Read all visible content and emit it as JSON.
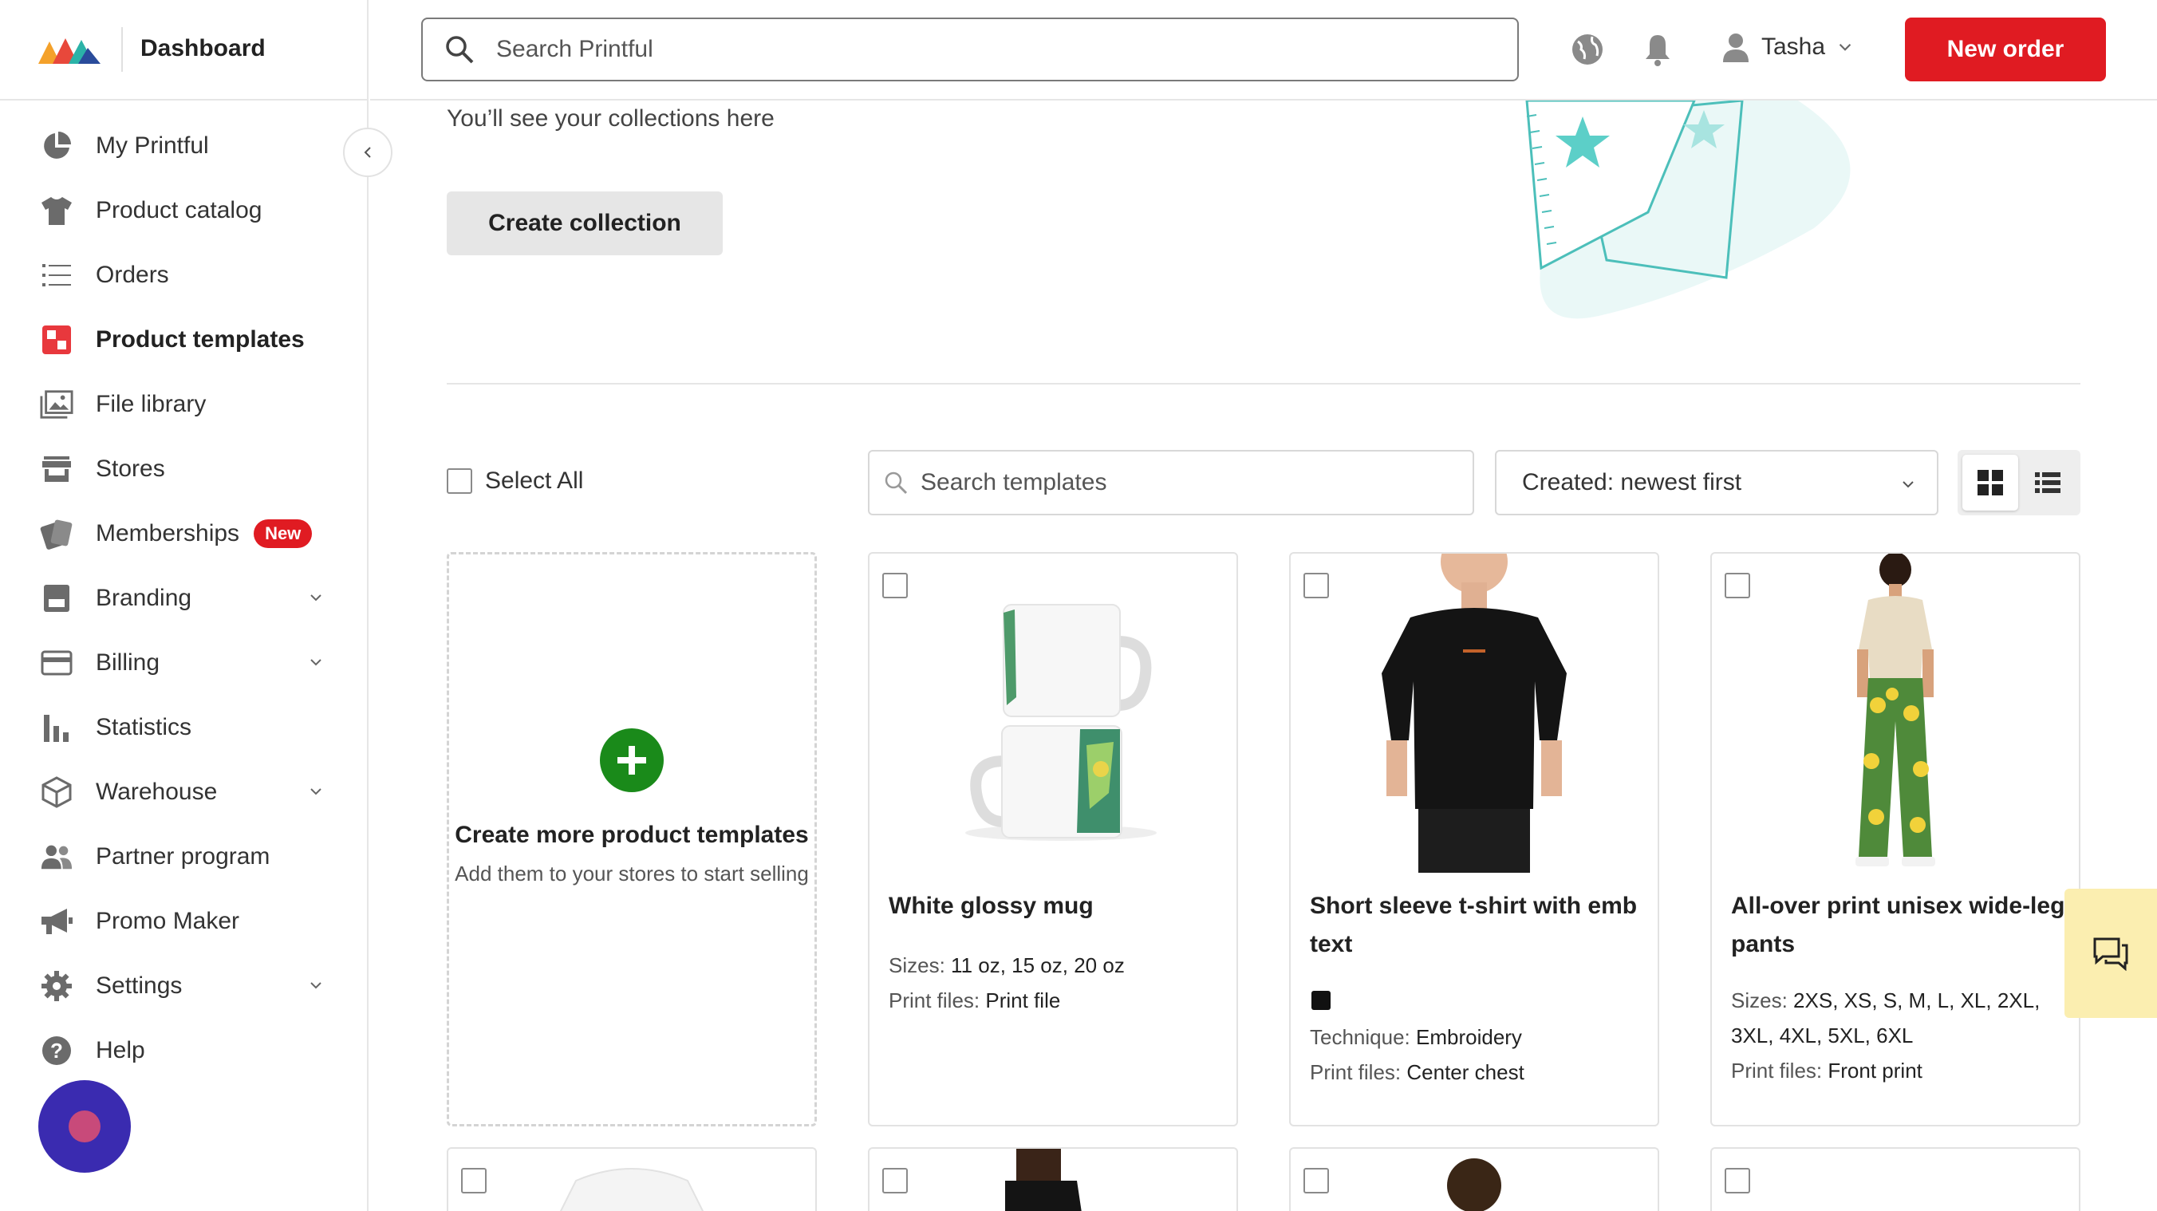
{
  "brand": {
    "title": "Dashboard"
  },
  "sidebar": {
    "items": [
      {
        "label": "My Printful",
        "icon": "pie-chart-icon"
      },
      {
        "label": "Product catalog",
        "icon": "tshirt-icon"
      },
      {
        "label": "Orders",
        "icon": "list-icon"
      },
      {
        "label": "Product templates",
        "icon": "templates-icon",
        "active": true
      },
      {
        "label": "File library",
        "icon": "images-icon"
      },
      {
        "label": "Stores",
        "icon": "store-icon"
      },
      {
        "label": "Memberships",
        "icon": "membership-cards-icon",
        "badge": "New"
      },
      {
        "label": "Branding",
        "icon": "branding-icon",
        "expandable": true
      },
      {
        "label": "Billing",
        "icon": "credit-card-icon",
        "expandable": true
      },
      {
        "label": "Statistics",
        "icon": "bar-chart-icon"
      },
      {
        "label": "Warehouse",
        "icon": "box-icon",
        "expandable": true
      },
      {
        "label": "Partner program",
        "icon": "people-icon"
      },
      {
        "label": "Promo Maker",
        "icon": "megaphone-icon"
      },
      {
        "label": "Settings",
        "icon": "gear-icon",
        "expandable": true
      },
      {
        "label": "Help",
        "icon": "help-icon"
      }
    ]
  },
  "header": {
    "search_placeholder": "Search Printful",
    "user_name": "Tasha",
    "new_order_label": "New order"
  },
  "collections": {
    "empty_text": "You’ll see your collections here",
    "create_label": "Create collection"
  },
  "toolbar": {
    "select_all_label": "Select All",
    "search_placeholder": "Search templates",
    "sort_label": "Created: newest first"
  },
  "create_card": {
    "title": "Create more product templates",
    "subtitle": "Add them to your stores to start selling"
  },
  "templates": [
    {
      "title": "White glossy mug",
      "sizes_label": "Sizes:",
      "sizes": "11 oz, 15 oz, 20 oz",
      "files_label": "Print files:",
      "files": "Print file"
    },
    {
      "title": "Short sleeve t-shirt with emb text",
      "technique_label": "Technique:",
      "technique": "Embroidery",
      "files_label": "Print files:",
      "files": "Center chest",
      "color": "#111111"
    },
    {
      "title": "All-over print unisex wide-leg pants",
      "sizes_label": "Sizes:",
      "sizes": "2XS, XS, S, M, L, XL, 2XL, 3XL, 4XL, 5XL, 6XL",
      "files_label": "Print files:",
      "files": "Front print"
    }
  ],
  "colors": {
    "accent": "#e01b22",
    "create_plus": "#1a8a1a",
    "chat_bg": "#fbeeb0",
    "fab_bg": "#3a2bb0"
  }
}
